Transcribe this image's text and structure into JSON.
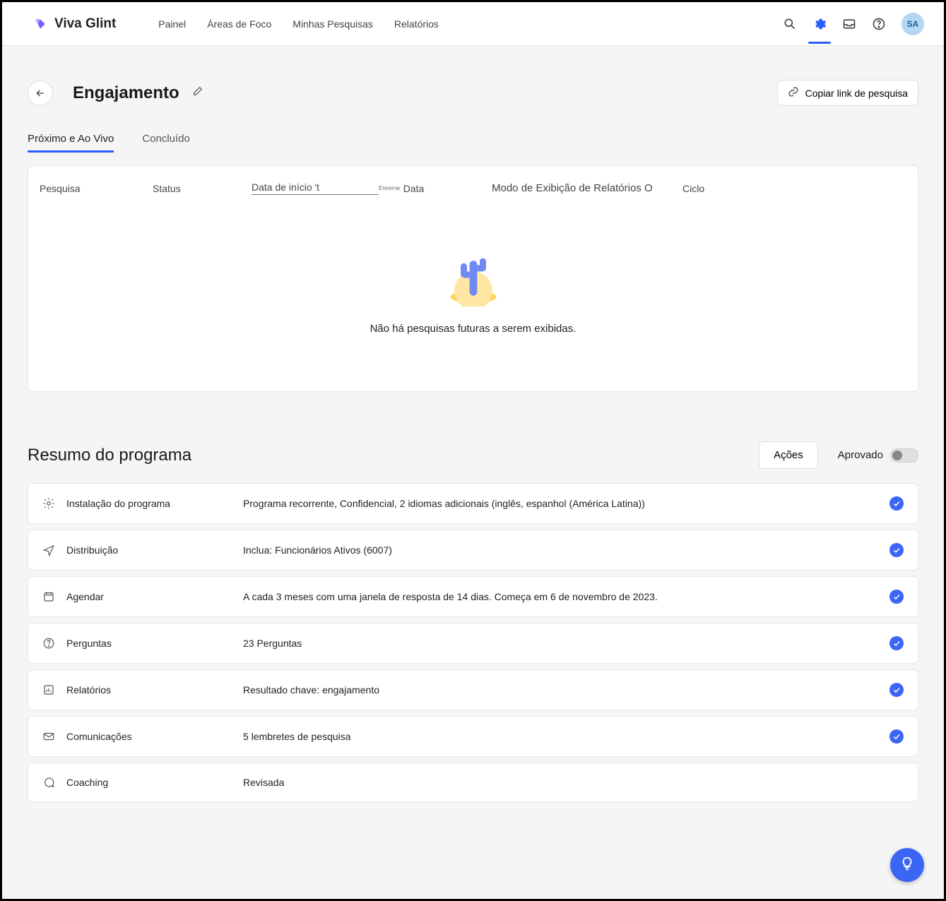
{
  "brand": {
    "name": "Viva Glint"
  },
  "nav": {
    "painel": "Painel",
    "areas": "Áreas de Foco",
    "minhas": "Minhas Pesquisas",
    "relatorios": "Relatórios"
  },
  "avatar": "SA",
  "page": {
    "title": "Engajamento",
    "copy_link": "Copiar link de pesquisa"
  },
  "tabs": {
    "upcoming": "Próximo e Ao Vivo",
    "completed": "Concluído"
  },
  "columns": {
    "pesquisa": "Pesquisa",
    "status": "Status",
    "data_inicio": "Data de início 't",
    "data_tiny": "Encerrar",
    "data": "Data",
    "modo": "Modo de Exibição de Relatórios O",
    "ciclo": "Ciclo"
  },
  "empty_text": "Não há pesquisas futuras a serem exibidas.",
  "summary": {
    "heading": "Resumo do programa",
    "actions": "Ações",
    "approved": "Aprovado",
    "rows": {
      "instalacao": {
        "label": "Instalação do programa",
        "desc": "Programa recorrente, Confidencial, 2 idiomas adicionais (inglês, espanhol (América Latina))"
      },
      "distribuicao": {
        "label": "Distribuição",
        "desc": "Inclua: Funcionários Ativos (6007)"
      },
      "agendar": {
        "label": "Agendar",
        "desc": "A cada 3 meses com uma janela de resposta de 14 dias. Começa em 6 de novembro de 2023."
      },
      "perguntas": {
        "label": "Perguntas",
        "desc": "23 Perguntas"
      },
      "relatorios": {
        "label": "Relatórios",
        "desc": "Resultado chave: engajamento"
      },
      "comunicacoes": {
        "label": "Comunicações",
        "desc": "5 lembretes de pesquisa"
      },
      "coaching": {
        "label": "Coaching",
        "desc": "Revisada"
      }
    }
  }
}
